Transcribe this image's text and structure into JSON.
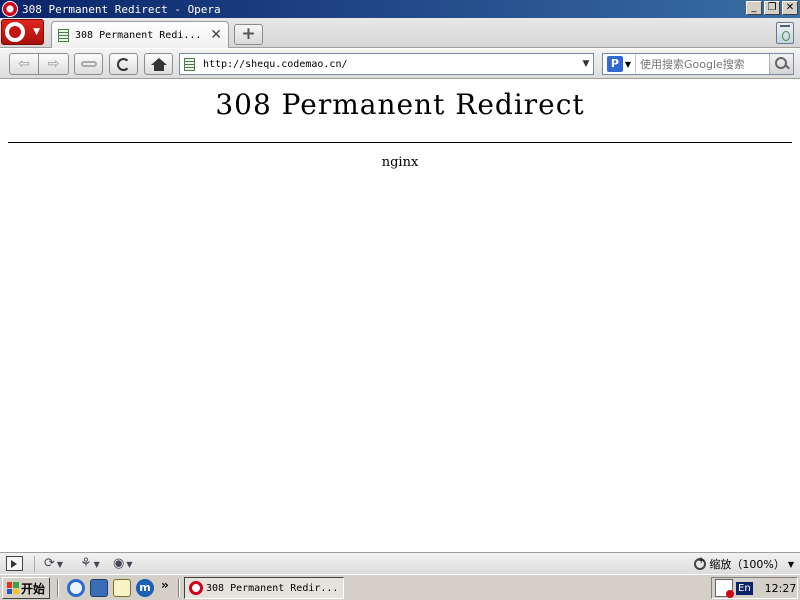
{
  "window": {
    "title": "308 Permanent Redirect - Opera",
    "minimize": "_",
    "restore": "❐",
    "close": "✕"
  },
  "tabs": [
    {
      "label": "308 Permanent Redi...",
      "close": "✕",
      "active": true
    }
  ],
  "tabbar": {
    "new_tab": "+"
  },
  "nav": {
    "url": "http://shequ.codemao.cn/",
    "search_placeholder": "使用搜索Google搜索",
    "search_engine_glyph": "P",
    "dropdown": "▼"
  },
  "page": {
    "heading": "308 Permanent Redirect",
    "server": "nginx"
  },
  "statusbar": {
    "zoom_label": "缩放（100%）",
    "dropdown": "▼"
  },
  "taskbar": {
    "start_label": "开始",
    "quick_launch_m": "m",
    "more": "»",
    "task_label": "308 Permanent Redir...",
    "lang": "En",
    "clock": "12:27"
  },
  "icons": {
    "opera_menu": "opera-logo-icon",
    "page": "page-icon",
    "key": "key-icon",
    "reload": "reload-icon",
    "home": "home-icon",
    "trash": "trash-icon"
  },
  "colors": {
    "titlebar_start": "#0a246a",
    "titlebar_end": "#3a6ea5",
    "opera_red": "#d0021b",
    "taskbar": "#d4d0c8"
  }
}
